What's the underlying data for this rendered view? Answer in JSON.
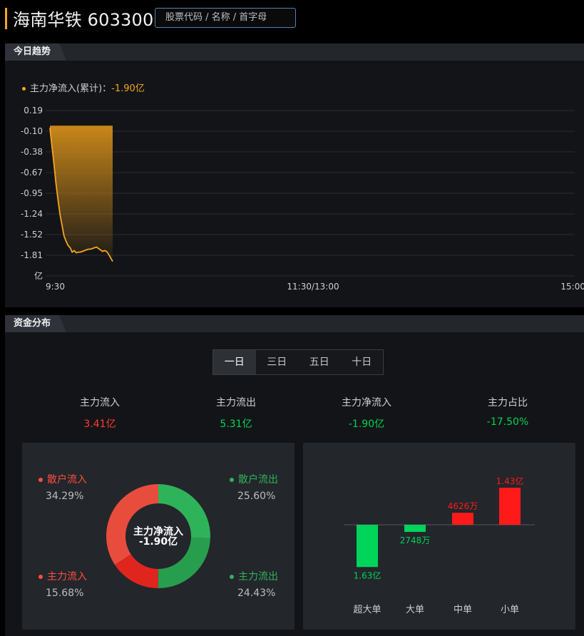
{
  "header": {
    "title": "海南华铁 603300",
    "search_placeholder": "股票代码 / 名称 / 首字母"
  },
  "trend": {
    "tab": "今日趋势",
    "legend_label": "主力净流入(累计)：",
    "legend_value": "-1.90亿",
    "unit": "亿",
    "colors": {
      "line": "#f5a623"
    },
    "chart_data": {
      "type": "area",
      "ylabel": "亿",
      "yticks": [
        "0.19",
        "-0.10",
        "-0.38",
        "-0.67",
        "-0.95",
        "-1.24",
        "-1.52",
        "-1.81"
      ],
      "ylim": [
        -2.1,
        0.19
      ],
      "xticks": [
        "9:30",
        "11:30/13:00",
        "15:00"
      ],
      "series": [
        {
          "values": [
            -0.05,
            -0.3,
            -0.55,
            -0.82,
            -1.05,
            -1.25,
            -1.4,
            -1.55,
            -1.62,
            -1.68,
            -1.71,
            -1.77,
            -1.75,
            -1.78,
            -1.77,
            -1.77,
            -1.76,
            -1.75,
            -1.74,
            -1.73,
            -1.73,
            -1.72,
            -1.71,
            -1.7,
            -1.72,
            -1.74,
            -1.76,
            -1.75,
            -1.76,
            -1.8,
            -1.85,
            -1.9
          ]
        }
      ]
    }
  },
  "dist": {
    "tab": "资金分布",
    "periods": [
      "一日",
      "三日",
      "五日",
      "十日"
    ],
    "active_period": 0,
    "stats": [
      {
        "label": "主力流入",
        "value": "3.41亿",
        "color": "red"
      },
      {
        "label": "主力流出",
        "value": "5.31亿",
        "color": "green"
      },
      {
        "label": "主力净流入",
        "value": "-1.90亿",
        "color": "green"
      },
      {
        "label": "主力占比",
        "value": "-17.50%",
        "color": "green"
      }
    ],
    "pie": {
      "center_label": "主力净流入",
      "center_value": "-1.90亿",
      "slices": [
        {
          "name": "散户流入",
          "pct": "34.29%",
          "value": 34.29,
          "color": "#e84c3d"
        },
        {
          "name": "散户流出",
          "pct": "25.60%",
          "value": 25.6,
          "color": "#2fb35a"
        },
        {
          "name": "主力流入",
          "pct": "15.68%",
          "value": 15.68,
          "color": "#e0251f"
        },
        {
          "name": "主力流出",
          "pct": "24.43%",
          "value": 24.43,
          "color": "#279e4e"
        }
      ]
    },
    "bars": {
      "chart_data": {
        "type": "bar",
        "categories": [
          "超大单",
          "大单",
          "中单",
          "小单"
        ],
        "values": [
          -1.63,
          -0.2748,
          0.4626,
          1.43
        ],
        "labels": [
          "1.63亿",
          "2748万",
          "4626万",
          "1.43亿"
        ],
        "colors": {
          "positive": "#ff1a1a",
          "negative": "#00d45a"
        }
      }
    }
  }
}
